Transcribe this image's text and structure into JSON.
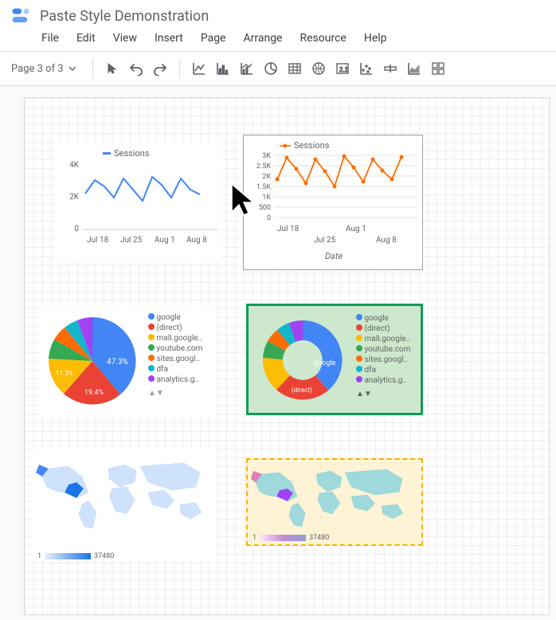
{
  "doc": {
    "title": "Paste Style Demonstration"
  },
  "menu": {
    "file": "File",
    "edit": "Edit",
    "view": "View",
    "insert": "Insert",
    "page": "Page",
    "arrange": "Arrange",
    "resource": "Resource",
    "help": "Help"
  },
  "toolbar": {
    "page_label": "Page 3 of 3"
  },
  "colors": {
    "blue": "#4285f4",
    "red": "#ea4335",
    "yellow": "#fbbc04",
    "green": "#34a853",
    "teal": "#12b5cb",
    "orange": "#ff6d01",
    "purple": "#a142f4"
  },
  "chart_data": [
    {
      "id": "sessions_left",
      "type": "line",
      "series": [
        {
          "name": "Sessions",
          "values": [
            2200,
            3000,
            2600,
            2100,
            3100,
            2400,
            2000,
            3200,
            2700,
            2100,
            3100,
            2500,
            2200
          ]
        }
      ],
      "x_ticks": [
        "Jul 18",
        "Jul 25",
        "Aug 1",
        "Aug 8"
      ],
      "y_ticks": [
        "0",
        "2K",
        "4K"
      ],
      "ylim": [
        0,
        4000
      ],
      "legend": "Sessions",
      "color": "#4285f4"
    },
    {
      "id": "sessions_right",
      "type": "line",
      "series": [
        {
          "name": "Sessions",
          "values": [
            2000,
            3000,
            2500,
            1900,
            3000,
            2400,
            1800,
            3100,
            2700,
            2000,
            3000,
            2500,
            2200,
            3100
          ]
        }
      ],
      "x_ticks": [
        "Jul 18",
        "Jul 25",
        "Aug 1",
        "Aug 8"
      ],
      "y_ticks": [
        "0",
        "500",
        "1K",
        "1.5K",
        "2K",
        "2.5K",
        "3K"
      ],
      "ylim": [
        0,
        3000
      ],
      "xlabel": "Date",
      "legend": "Sessions",
      "color": "#ff6d01"
    },
    {
      "id": "pie_left",
      "type": "pie",
      "categories": [
        "google",
        "(direct)",
        "mall.google..",
        "youtube.com",
        "sites.googl..",
        "dfa",
        "analytics.g.."
      ],
      "values": [
        47.3,
        19.4,
        11.3,
        8,
        6,
        4,
        4
      ],
      "labels_shown": {
        "google": "47.3%",
        "(direct)": "19.4%",
        "mall.google..": "11.3%"
      }
    },
    {
      "id": "pie_right",
      "type": "pie",
      "categories": [
        "google",
        "(direct)",
        "mall.google..",
        "youtube.com",
        "sites.googl..",
        "dfa",
        "analytics.g.."
      ],
      "values": [
        47.3,
        19.4,
        11.3,
        8,
        6,
        4,
        4
      ],
      "donut": true,
      "labels_shown": {
        "google": "google",
        "(direct)": "(direct)"
      }
    },
    {
      "id": "map_left",
      "type": "map",
      "scale": {
        "min": 1,
        "max": 37480,
        "palette": [
          "#e8f0fe",
          "#1a73e8"
        ]
      }
    },
    {
      "id": "map_right",
      "type": "map",
      "scale": {
        "min": 1,
        "max": 37480,
        "palette": [
          "#fde7f3",
          "#a142f4",
          "#12b5cb"
        ]
      }
    }
  ]
}
